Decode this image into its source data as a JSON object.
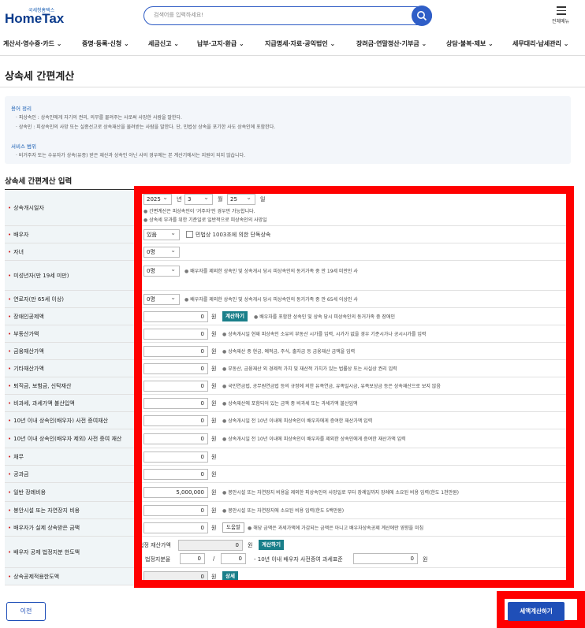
{
  "header": {
    "logo_sub": "국세청홈택스",
    "logo_main": "HomeTax",
    "search_placeholder": "검색어를 입력하세요!",
    "menu_label": "전체메뉴"
  },
  "nav": [
    "계산서·영수증·카드",
    "증명·등록·신청",
    "세금신고",
    "납부·고지·환급",
    "지급명세·자료·공익법인",
    "장려금·연말정산·기부금",
    "상담·불복·제보",
    "세무대리·납세관리"
  ],
  "page_title": "상속세 간편계산",
  "info": {
    "terms_title": "용어 정리",
    "terms": [
      "· 피상속인 : 상속인에게 자기의 권리, 의무를 물려주는 사로써 사망한 사람을 말한다.",
      "· 상속인 : 피상속인의 사망 또는 실종선고로 상속재산을 물려받는 사람을 말한다. 단, 민법상 상속을 포기한 사도 상속인에 포함한다."
    ],
    "scope_title": "서비스 범위",
    "scope": "· 비거주자 또는 수유자가 상속(유증) 받은 재산과 상속인 아닌 사의 경우에는 본 계산기에서는 지원이 되지 않습니다."
  },
  "section_title": "상속세 간편계산 입력",
  "form": {
    "death_date": {
      "label": "상속개시일자",
      "year": "2025",
      "year_unit": "년",
      "month": "3",
      "month_unit": "월",
      "day": "25",
      "day_unit": "일",
      "note1": "간편계산은 피상속인이 '거주자'인 경우만 가능합니다.",
      "note2": "상속세 부과를 위한 기준일로 일반적으로 피상속인의 사망일"
    },
    "spouse": {
      "label": "배우자",
      "value": "있음",
      "check_label": "민법상 1003조에 의한 단독상속"
    },
    "children": {
      "label": "자녀",
      "value": "0명"
    },
    "minors": {
      "label": "미성년자(만 19세 미만)",
      "value": "0명",
      "note": "배우자를 제외한 상속인 및 상속개시 당시 피상속인의 동거가족 중 만 19세 미만인 사"
    },
    "elderly": {
      "label": "연로자(만 65세 이상)",
      "value": "0명",
      "note": "배우자를 제외한 상속인 및 상속개시 당시 피상속인의 동거가족 중 만 65세 이상인 사"
    },
    "disabled": {
      "label": "장애인공제액",
      "value": "0",
      "unit": "원",
      "btn": "계산하기",
      "note": "배우자를 포함한 상속인 및 상속 당시 피상속인의 동거가족 중 장애인"
    },
    "realestate": {
      "label": "부동산가액",
      "value": "0",
      "unit": "원",
      "note": "상속개시일 현재 피상속인 소유의 부동산 시가를 입력, 시가가 없을 경우 기준시가나 공시시가를 입력"
    },
    "financial": {
      "label": "금융재산가액",
      "value": "0",
      "unit": "원",
      "note": "상속재산 중 현금, 예적금, 주식, 출자금 등 금융재산 금액을 입력"
    },
    "other_assets": {
      "label": "기타재산가액",
      "value": "0",
      "unit": "원",
      "note": "부동산, 금융재산 외 경제적 가치 및 재산적 가치가 있는 법률상 또는 사실상 권리 입력"
    },
    "retirement": {
      "label": "퇴직금, 보험금, 신탁재산",
      "value": "0",
      "unit": "원",
      "note": "국민연금법, 공무원연금법 등의 규정에 의한 유족연금, 유족일시금, 유족보상금 등은 상속재산으로 보지 않음"
    },
    "nontaxable": {
      "label": "비과세, 과세가액 불산입액",
      "value": "0",
      "unit": "원",
      "note": "상속재산에 포함되어 있는 금액 중 비과세 또는 과세가액 불산입액"
    },
    "gift_spouse": {
      "label": "10년 이내 상속인(배우자) 사전 증여재산",
      "value": "0",
      "unit": "원",
      "note": "상속개시일 전 10년 이내에 피상속인이 배우자에게 증여한 재산가액 입력"
    },
    "gift_other": {
      "label": "10년 이내 상속인(배우자 제외) 사전 증여 재산",
      "value": "0",
      "unit": "원",
      "note": "상속개시일 전 10년 이내에 피상속인이 배우자를 제외한 상속인에게 증여한 재산가액 입력"
    },
    "debt": {
      "label": "채무",
      "value": "0",
      "unit": "원"
    },
    "taxes": {
      "label": "공과금",
      "value": "0",
      "unit": "원"
    },
    "funeral": {
      "label": "일반 장례비용",
      "value": "5,000,000",
      "unit": "원",
      "note": "봉안시설 또는 자연장지 비용을 제외한 피상속인의 사망일로 부터 장례일까지 장례에 소요된 비용 입력(한도 1천만원)"
    },
    "memorial": {
      "label": "봉안시설 또는 자연장지 비용",
      "value": "0",
      "unit": "원",
      "note": "봉안시설 또는 자연장지에 소요된 비용 입력(한도 5백만원)"
    },
    "spouse_actual": {
      "label": "배우자가 실제 상속받은 금액",
      "value": "0",
      "unit": "원",
      "btn": "도움말",
      "note": "해당 금액은 과세가액에 가감되는 금액은 아니고 배우자상속공제 계산에만 영향을 미침"
    },
    "spouse_limit": {
      "label": "배우자 공제 법정지분 한도액",
      "legal_value_label": "법정 재산가액",
      "legal_value": "0",
      "unit": "원",
      "btn": "계산하기",
      "share_label": "법정지분율",
      "share_num": "0",
      "share_sep": "/",
      "share_den": "0",
      "gift_label": "- 10년 이내 배우자 사전증여 과세표준",
      "gift_value": "0",
      "gift_unit": "원"
    },
    "deduction_limit": {
      "label": "상속공제적용한도액",
      "value": "0",
      "unit": "원",
      "btn": "상세"
    }
  },
  "buttons": {
    "prev": "이전",
    "calculate": "세액계산하기"
  },
  "colors": {
    "brand": "#1f4fb8",
    "highlight": "#ff0000",
    "teal": "#1a7f8a",
    "label_bg": "#f0f5f7"
  }
}
